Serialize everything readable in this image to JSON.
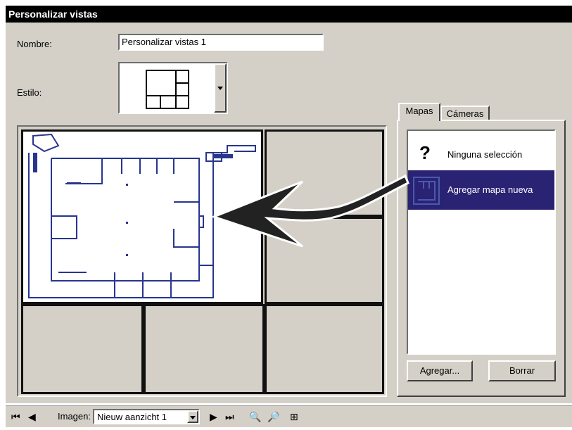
{
  "window": {
    "title": "Personalizar vistas"
  },
  "form": {
    "name_label": "Nombre:",
    "name_value": "Personalizar vistas 1",
    "style_label": "Estilo:"
  },
  "tabs": [
    {
      "label": "Mapas",
      "active": true
    },
    {
      "label": "Cámeras",
      "active": false
    }
  ],
  "maps_list": {
    "items": [
      {
        "label": "Ninguna selección",
        "icon": "question-icon",
        "selected": false
      },
      {
        "label": "Agregar mapa nueva",
        "icon": "floorplan-thumbnail",
        "selected": true
      }
    ]
  },
  "buttons": {
    "add": "Agregar...",
    "delete": "Borrar"
  },
  "bottom_bar": {
    "image_label": "Imagen:",
    "image_value": "Nieuw aanzicht 1"
  },
  "colors": {
    "title_bar": "#000000",
    "face": "#d4d0c8",
    "selection": "#2a2272",
    "floorplan_line": "#28358f"
  }
}
